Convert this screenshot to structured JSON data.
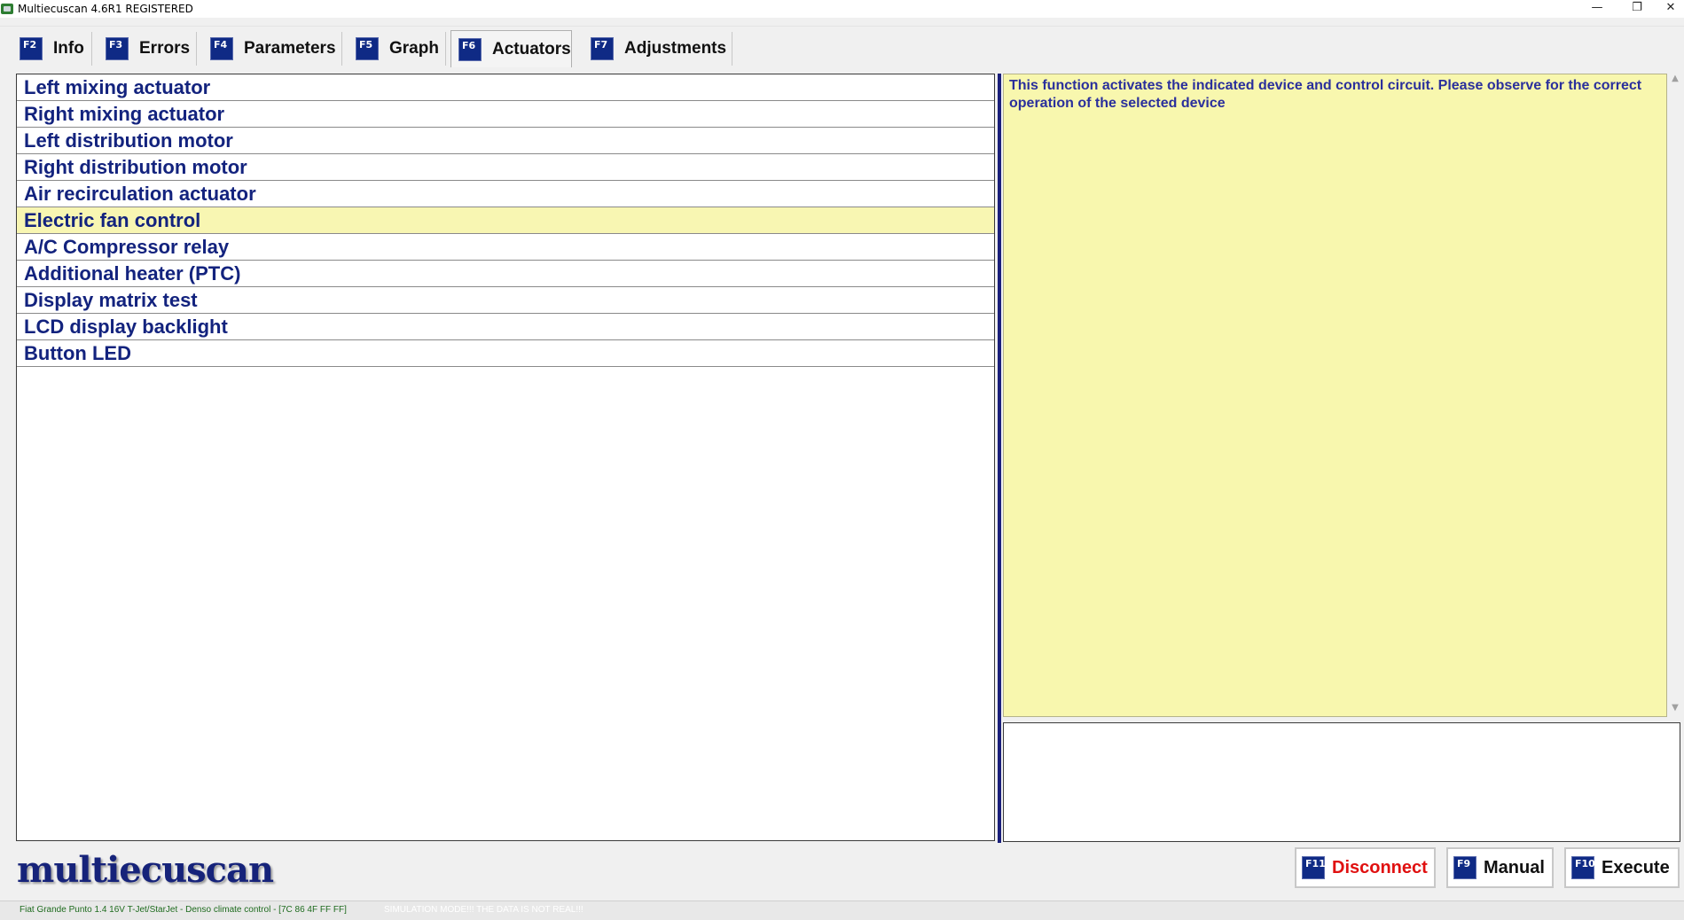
{
  "window": {
    "title": "Multiecuscan 4.6R1 REGISTERED",
    "minimize_glyph": "—",
    "restore_glyph": "❐",
    "close_glyph": "✕"
  },
  "tabs": [
    {
      "key": "F2",
      "label": "Info"
    },
    {
      "key": "F3",
      "label": "Errors"
    },
    {
      "key": "F4",
      "label": "Parameters"
    },
    {
      "key": "F5",
      "label": "Graph"
    },
    {
      "key": "F6",
      "label": "Actuators",
      "active": true
    },
    {
      "key": "F7",
      "label": "Adjustments"
    }
  ],
  "actuators": {
    "items": [
      "Left mixing actuator",
      "Right mixing actuator",
      "Left distribution motor",
      "Right distribution motor",
      "Air recirculation actuator",
      "Electric fan control",
      "A/C Compressor relay",
      "Additional heater (PTC)",
      "Display matrix test",
      "LCD display backlight",
      "Button LED"
    ],
    "selected_index": 5
  },
  "description": {
    "text": "This function activates the indicated device and control circuit. Please observe for the correct operation of the selected device"
  },
  "scroll": {
    "up_glyph": "▲",
    "down_glyph": "▼"
  },
  "logo": {
    "text": "multiecuscan"
  },
  "buttons": {
    "disconnect": {
      "key": "F11",
      "label": "Disconnect"
    },
    "manual": {
      "key": "F9",
      "label": "Manual"
    },
    "execute": {
      "key": "F10",
      "label": "Execute"
    }
  },
  "status": {
    "vehicle": "Fiat Grande Punto 1.4 16V T-Jet/StarJet - Denso climate control - [7C 86 4F FF FF]",
    "simulation": "SIMULATION MODE!!! THE DATA IS NOT REAL!!!"
  },
  "colors": {
    "accent_navy": "#0f2a85",
    "list_text": "#13237e",
    "selected_row": "#f8f6b2",
    "description_bg": "#f8f7ae",
    "disconnect_red": "#e01010"
  }
}
